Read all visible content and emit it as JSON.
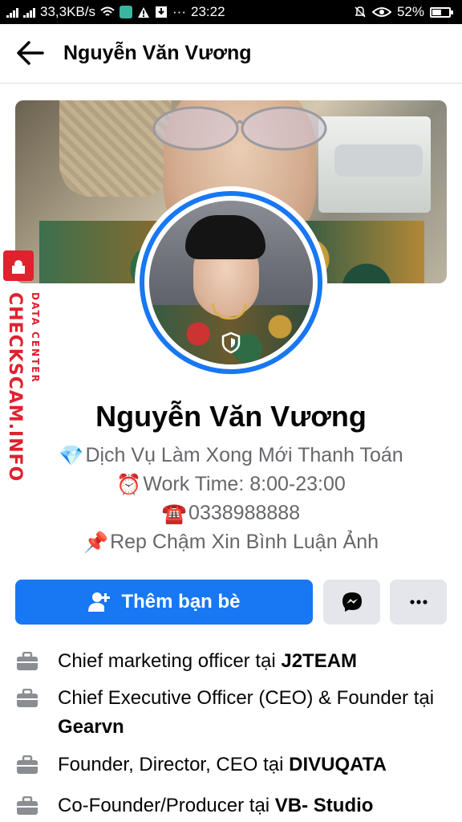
{
  "status_bar": {
    "network_speed": "33,3KB/s",
    "time": "23:22",
    "dots": "···",
    "battery": "52%"
  },
  "header": {
    "title": "Nguyễn Văn Vương"
  },
  "watermark": {
    "brand": "CHECKSCAM.INFO",
    "sub": "DATA CENTER"
  },
  "profile": {
    "name": "Nguyễn Văn Vương",
    "bio": [
      {
        "emoji": "💎",
        "text": "Dịch Vụ Làm Xong Mới Thanh Toán"
      },
      {
        "emoji": "⏰",
        "text": "Work Time: 8:00-23:00"
      },
      {
        "emoji": "☎️",
        "text": "0338988888"
      },
      {
        "emoji": "📌",
        "text": "Rep Chậm Xin Bình Luận Ảnh"
      }
    ]
  },
  "actions": {
    "add_friend_label": "Thêm bạn bè",
    "more_label": "···"
  },
  "work": [
    {
      "prefix": "Chief marketing officer tại ",
      "company": "J2TEAM"
    },
    {
      "prefix": "Chief Executive Officer (CEO) & Founder tại ",
      "company": "Gearvn"
    },
    {
      "prefix": "Founder, Director, CEO tại ",
      "company": "DIVUQATA"
    },
    {
      "prefix": "Co-Founder/Producer tại ",
      "company": "VB- Studio"
    }
  ],
  "colors": {
    "accent": "#1877f2",
    "secondary_text": "#65676b",
    "watermark": "#e0212e"
  }
}
